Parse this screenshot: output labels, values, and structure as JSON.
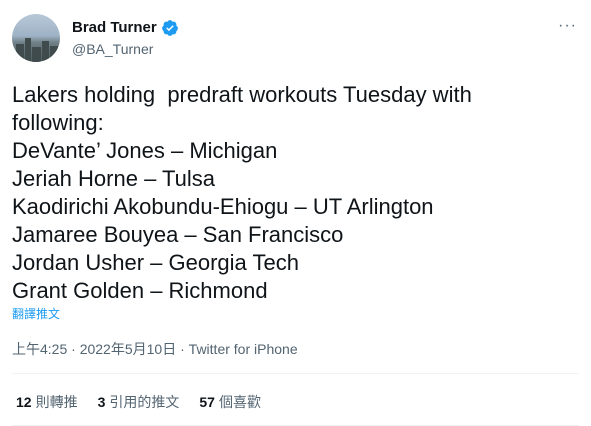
{
  "author": {
    "name": "Brad Turner",
    "handle": "@BA_Turner",
    "verified": true
  },
  "more_icon": "···",
  "tweet": {
    "lines": [
      "Lakers holding  predraft workouts Tuesday with",
      "following:",
      "DeVante’ Jones – Michigan",
      "Jeriah Horne – Tulsa",
      "Kaodirichi Akobundu-Ehiogu – UT Arlington",
      "Jamaree Bouyea – San Francisco",
      "Jordan Usher – Georgia Tech",
      "Grant Golden – Richmond"
    ]
  },
  "translate_label": "翻譯推文",
  "meta": {
    "time": "上午4:25",
    "date": "2022年5月10日",
    "source": "Twitter for iPhone",
    "sep": "·"
  },
  "stats": {
    "retweets": {
      "num": "12",
      "label": "則轉推"
    },
    "quotes": {
      "num": "3",
      "label": "引用的推文"
    },
    "likes": {
      "num": "57",
      "label": "個喜歡"
    }
  },
  "colors": {
    "verified": "#1d9bf0",
    "link": "#1d9bf0",
    "muted": "#536471"
  }
}
